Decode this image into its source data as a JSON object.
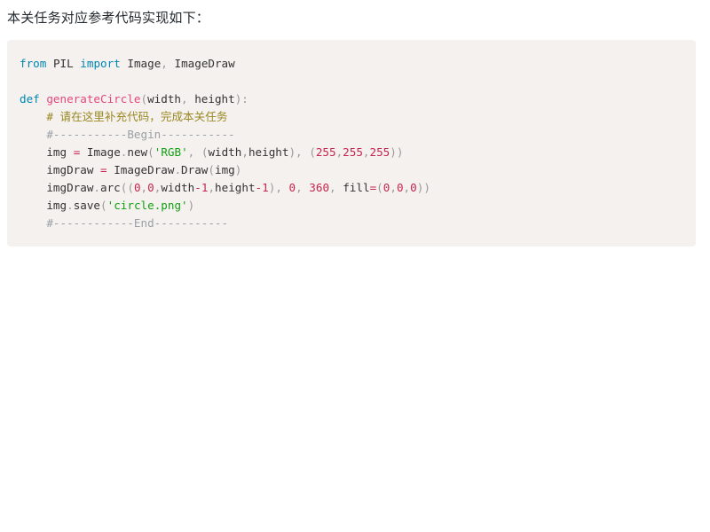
{
  "page": {
    "heading": "本关任务对应参考代码实现如下："
  },
  "code_block": {
    "language": "python",
    "background_color": "#f5f1ef",
    "lines": [
      {
        "id": "line-1",
        "indent": 0,
        "tokens": [
          {
            "t": "from",
            "c": "kw"
          },
          {
            "t": " ",
            "c": "plain"
          },
          {
            "t": "PIL",
            "c": "name"
          },
          {
            "t": " ",
            "c": "plain"
          },
          {
            "t": "import",
            "c": "kw"
          },
          {
            "t": " ",
            "c": "plain"
          },
          {
            "t": "Image",
            "c": "name"
          },
          {
            "t": ",",
            "c": "punc"
          },
          {
            "t": " ",
            "c": "plain"
          },
          {
            "t": "ImageDraw",
            "c": "name"
          }
        ]
      },
      {
        "id": "line-2",
        "indent": 0,
        "tokens": []
      },
      {
        "id": "line-3",
        "indent": 0,
        "tokens": [
          {
            "t": "def",
            "c": "def"
          },
          {
            "t": " ",
            "c": "plain"
          },
          {
            "t": "generateCircle",
            "c": "fn"
          },
          {
            "t": "(",
            "c": "punc"
          },
          {
            "t": "width",
            "c": "name"
          },
          {
            "t": ",",
            "c": "punc"
          },
          {
            "t": " ",
            "c": "plain"
          },
          {
            "t": "height",
            "c": "name"
          },
          {
            "t": ")",
            "c": "punc"
          },
          {
            "t": ":",
            "c": "punc"
          }
        ]
      },
      {
        "id": "line-4",
        "indent": 4,
        "tokens": [
          {
            "t": "# 请在这里补充代码，完成本关任务",
            "c": "comment"
          }
        ]
      },
      {
        "id": "line-5",
        "indent": 4,
        "tokens": [
          {
            "t": "#-----------Begin-----------",
            "c": "comment-dash"
          }
        ]
      },
      {
        "id": "line-6",
        "indent": 4,
        "tokens": [
          {
            "t": "img",
            "c": "name"
          },
          {
            "t": " ",
            "c": "plain"
          },
          {
            "t": "=",
            "c": "op"
          },
          {
            "t": " ",
            "c": "plain"
          },
          {
            "t": "Image",
            "c": "name"
          },
          {
            "t": ".",
            "c": "punc"
          },
          {
            "t": "new",
            "c": "name"
          },
          {
            "t": "(",
            "c": "punc"
          },
          {
            "t": "'RGB'",
            "c": "str"
          },
          {
            "t": ",",
            "c": "punc"
          },
          {
            "t": " ",
            "c": "plain"
          },
          {
            "t": "(",
            "c": "punc"
          },
          {
            "t": "width",
            "c": "name"
          },
          {
            "t": ",",
            "c": "punc"
          },
          {
            "t": "height",
            "c": "name"
          },
          {
            "t": ")",
            "c": "punc"
          },
          {
            "t": ",",
            "c": "punc"
          },
          {
            "t": " ",
            "c": "plain"
          },
          {
            "t": "(",
            "c": "punc"
          },
          {
            "t": "255",
            "c": "num"
          },
          {
            "t": ",",
            "c": "punc"
          },
          {
            "t": "255",
            "c": "num"
          },
          {
            "t": ",",
            "c": "punc"
          },
          {
            "t": "255",
            "c": "num"
          },
          {
            "t": ")",
            "c": "punc"
          },
          {
            "t": ")",
            "c": "punc"
          }
        ]
      },
      {
        "id": "line-7",
        "indent": 4,
        "tokens": [
          {
            "t": "imgDraw",
            "c": "name"
          },
          {
            "t": " ",
            "c": "plain"
          },
          {
            "t": "=",
            "c": "op"
          },
          {
            "t": " ",
            "c": "plain"
          },
          {
            "t": "ImageDraw",
            "c": "name"
          },
          {
            "t": ".",
            "c": "punc"
          },
          {
            "t": "Draw",
            "c": "name"
          },
          {
            "t": "(",
            "c": "punc"
          },
          {
            "t": "img",
            "c": "name"
          },
          {
            "t": ")",
            "c": "punc"
          }
        ]
      },
      {
        "id": "line-8",
        "indent": 4,
        "tokens": [
          {
            "t": "imgDraw",
            "c": "name"
          },
          {
            "t": ".",
            "c": "punc"
          },
          {
            "t": "arc",
            "c": "name"
          },
          {
            "t": "(",
            "c": "punc"
          },
          {
            "t": "(",
            "c": "punc"
          },
          {
            "t": "0",
            "c": "num"
          },
          {
            "t": ",",
            "c": "punc"
          },
          {
            "t": "0",
            "c": "num"
          },
          {
            "t": ",",
            "c": "punc"
          },
          {
            "t": "width",
            "c": "name"
          },
          {
            "t": "-",
            "c": "op"
          },
          {
            "t": "1",
            "c": "num"
          },
          {
            "t": ",",
            "c": "punc"
          },
          {
            "t": "height",
            "c": "name"
          },
          {
            "t": "-",
            "c": "op"
          },
          {
            "t": "1",
            "c": "num"
          },
          {
            "t": ")",
            "c": "punc"
          },
          {
            "t": ",",
            "c": "punc"
          },
          {
            "t": " ",
            "c": "plain"
          },
          {
            "t": "0",
            "c": "num"
          },
          {
            "t": ",",
            "c": "punc"
          },
          {
            "t": " ",
            "c": "plain"
          },
          {
            "t": "360",
            "c": "num"
          },
          {
            "t": ",",
            "c": "punc"
          },
          {
            "t": " ",
            "c": "plain"
          },
          {
            "t": "fill",
            "c": "attr"
          },
          {
            "t": "=",
            "c": "op"
          },
          {
            "t": "(",
            "c": "punc"
          },
          {
            "t": "0",
            "c": "num"
          },
          {
            "t": ",",
            "c": "punc"
          },
          {
            "t": "0",
            "c": "num"
          },
          {
            "t": ",",
            "c": "punc"
          },
          {
            "t": "0",
            "c": "num"
          },
          {
            "t": ")",
            "c": "punc"
          },
          {
            "t": ")",
            "c": "punc"
          }
        ]
      },
      {
        "id": "line-9",
        "indent": 4,
        "tokens": [
          {
            "t": "img",
            "c": "name"
          },
          {
            "t": ".",
            "c": "punc"
          },
          {
            "t": "save",
            "c": "name"
          },
          {
            "t": "(",
            "c": "punc"
          },
          {
            "t": "'circle.png'",
            "c": "str"
          },
          {
            "t": ")",
            "c": "punc"
          }
        ]
      },
      {
        "id": "line-10",
        "indent": 4,
        "tokens": [
          {
            "t": "#------------End-----------",
            "c": "comment-dash"
          }
        ]
      }
    ]
  }
}
